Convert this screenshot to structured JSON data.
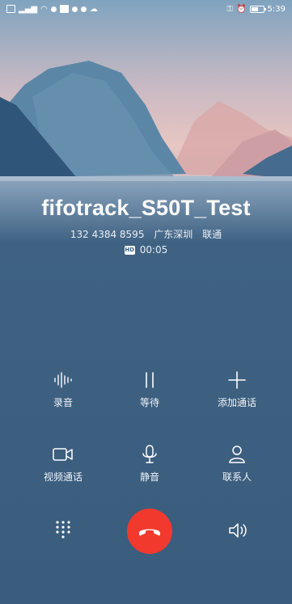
{
  "status_bar": {
    "time": "5:39",
    "battery_level": 0.6
  },
  "caller": {
    "name": "fifotrack_S50T_Test",
    "number": "132 4384 8595",
    "location": "广东深圳",
    "carrier": "联通",
    "hd_label": "HD",
    "duration": "00:05"
  },
  "controls": {
    "record": "录音",
    "hold": "等待",
    "add_call": "添加通话",
    "video_call": "视频通话",
    "mute": "静音",
    "contacts": "联系人"
  },
  "icons": {
    "keypad": "keypad-icon",
    "hangup": "hangup-icon",
    "speaker": "speaker-icon"
  },
  "colors": {
    "background": "#3f6283",
    "hangup": "#f2392e",
    "text": "#ffffff"
  }
}
